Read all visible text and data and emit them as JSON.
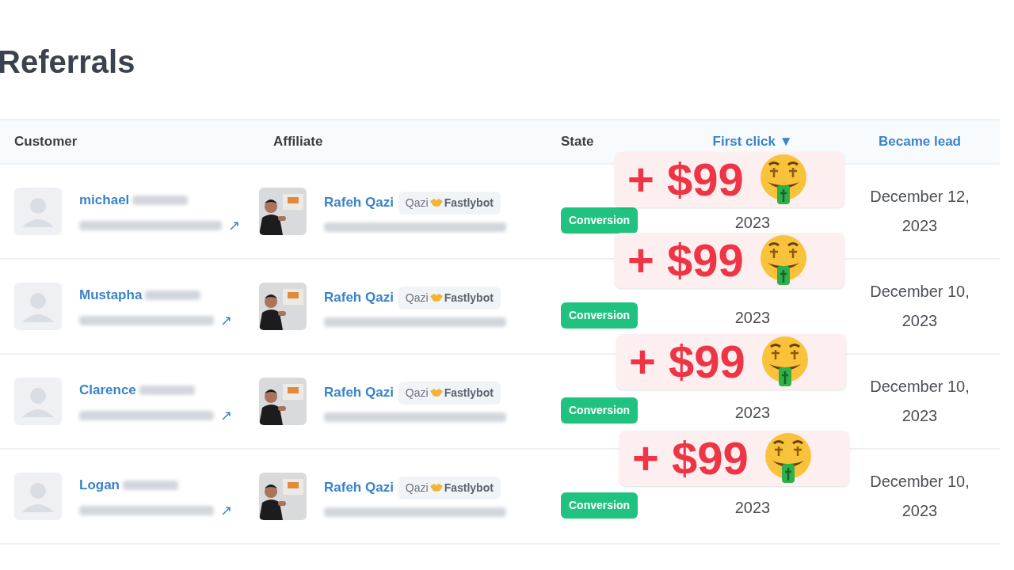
{
  "title": "Referrals",
  "columns": [
    {
      "label": "Customer",
      "sortable": false
    },
    {
      "label": "Affiliate",
      "sortable": false
    },
    {
      "label": "State",
      "sortable": false
    },
    {
      "label": "First click",
      "sortable": true,
      "sort_indicator": "▼"
    },
    {
      "label": "Became lead",
      "sortable": true
    }
  ],
  "rows": [
    {
      "customer": "michael",
      "link_icon": "↗",
      "affiliate": "Rafeh Qazi",
      "tag": "Qazi",
      "tag_brand": "Fastlybot",
      "state": "Conversion",
      "first_click": "2023",
      "became_lead": "December 12, 2023",
      "bonus": "+ $99"
    },
    {
      "customer": "Mustapha",
      "link_icon": "↗",
      "affiliate": "Rafeh Qazi",
      "tag": "Qazi",
      "tag_brand": "Fastlybot",
      "state": "Conversion",
      "first_click": "2023",
      "became_lead": "December 10, 2023",
      "bonus": "+ $99"
    },
    {
      "customer": "Clarence",
      "link_icon": "↗",
      "affiliate": "Rafeh Qazi",
      "tag": "Qazi",
      "tag_brand": "Fastlybot",
      "state": "Conversion",
      "first_click": "2023",
      "became_lead": "December 10, 2023",
      "bonus": "+ $99"
    },
    {
      "customer": "Logan",
      "link_icon": "↗",
      "affiliate": "Rafeh Qazi",
      "tag": "Qazi",
      "tag_brand": "Fastlybot",
      "state": "Conversion",
      "first_click": "2023",
      "became_lead": "December 10, 2023",
      "bonus": "+ $99"
    }
  ]
}
